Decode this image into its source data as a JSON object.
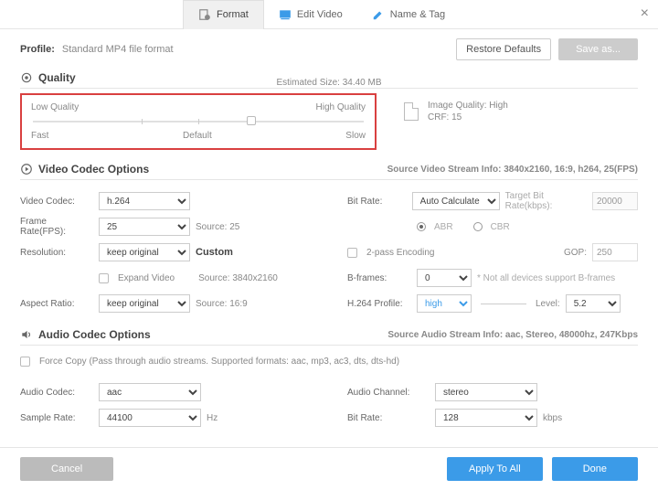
{
  "tabs": {
    "format": "Format",
    "edit": "Edit Video",
    "name_tag": "Name & Tag"
  },
  "profile": {
    "label": "Profile:",
    "value": "Standard MP4 file format"
  },
  "buttons": {
    "restore": "Restore Defaults",
    "save_as": "Save as...",
    "cancel": "Cancel",
    "apply_all": "Apply To All",
    "done": "Done",
    "custom": "Custom"
  },
  "quality": {
    "header": "Quality",
    "est_label": "Estimated Size: 34.40 MB",
    "low": "Low Quality",
    "high": "High Quality",
    "fast": "Fast",
    "default": "Default",
    "slow": "Slow",
    "image_quality": "Image Quality: High",
    "crf": "CRF: 15"
  },
  "video": {
    "header": "Video Codec Options",
    "stream_info": "Source Video Stream Info: 3840x2160, 16:9, h264, 25(FPS)",
    "codec_label": "Video Codec:",
    "codec_value": "h.264",
    "fps_label": "Frame Rate(FPS):",
    "fps_value": "25",
    "fps_src": "Source: 25",
    "res_label": "Resolution:",
    "res_value": "keep original",
    "res_src": "Source: 3840x2160",
    "expand": "Expand Video",
    "aspect_label": "Aspect Ratio:",
    "aspect_value": "keep original",
    "aspect_src": "Source: 16:9",
    "bitrate_label": "Bit Rate:",
    "bitrate_value": "Auto Calculate",
    "target_label": "Target Bit Rate(kbps):",
    "target_value": "20000",
    "abr": "ABR",
    "cbr": "CBR",
    "twopass": "2-pass Encoding",
    "gop_label": "GOP:",
    "gop_value": "250",
    "bframes_label": "B-frames:",
    "bframes_value": "0",
    "bframes_note": "* Not all devices support B-frames",
    "profile_label": "H.264 Profile:",
    "profile_value": "high",
    "level_label": "Level:",
    "level_value": "5.2"
  },
  "audio": {
    "header": "Audio Codec Options",
    "stream_info": "Source Audio Stream Info: aac, Stereo, 48000hz, 247Kbps",
    "force_copy": "Force Copy (Pass through audio streams. Supported formats: aac, mp3, ac3, dts, dts-hd)",
    "codec_label": "Audio Codec:",
    "codec_value": "aac",
    "sr_label": "Sample Rate:",
    "sr_value": "44100",
    "sr_unit": "Hz",
    "channel_label": "Audio Channel:",
    "channel_value": "stereo",
    "bitrate_label": "Bit Rate:",
    "bitrate_value": "128",
    "bitrate_unit": "kbps"
  }
}
